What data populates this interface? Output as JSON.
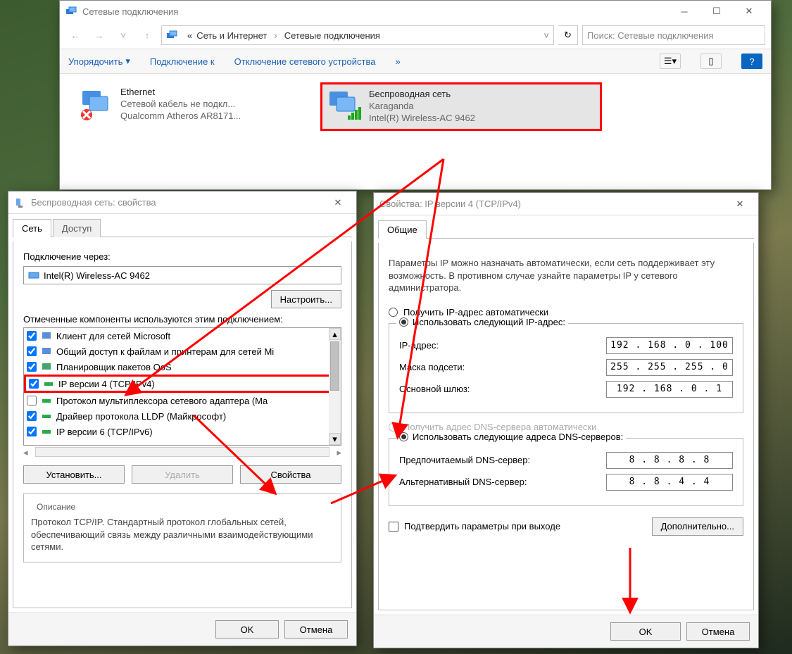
{
  "explorer": {
    "title": "Сетевые подключения",
    "breadcrumb": {
      "root": "«",
      "p1": "Сеть и Интернет",
      "p2": "Сетевые подключения"
    },
    "search_placeholder": "Поиск: Сетевые подключения",
    "cmdbar": {
      "organize": "Упорядочить",
      "connect": "Подключение к",
      "disable": "Отключение сетевого устройства",
      "chev": "»"
    },
    "ethernet": {
      "name": "Ethernet",
      "status": "Сетевой кабель не подкл...",
      "device": "Qualcomm Atheros AR8171..."
    },
    "wireless": {
      "name": "Беспроводная сеть",
      "status": "Karaganda",
      "device": "Intel(R) Wireless-AC 9462"
    }
  },
  "dlg_props": {
    "title": "Беспроводная сеть: свойства",
    "tab_net": "Сеть",
    "tab_access": "Доступ",
    "connect_via_label": "Подключение через:",
    "adapter_name": "Intel(R) Wireless-AC 9462",
    "configure_btn": "Настроить...",
    "components_label": "Отмеченные компоненты используются этим подключением:",
    "items": [
      "Клиент для сетей Microsoft",
      "Общий доступ к файлам и принтерам для сетей Mi",
      "Планировщик пакетов QoS",
      "IP версии 4 (TCP/IPv4)",
      "Протокол мультиплексора сетевого адаптера (Ma",
      "Драйвер протокола LLDP (Майкрософт)",
      "IP версии 6 (TCP/IPv6)"
    ],
    "install_btn": "Установить...",
    "remove_btn": "Удалить",
    "props_btn": "Свойства",
    "desc_title": "Описание",
    "desc_text": "Протокол TCP/IP. Стандартный протокол глобальных сетей, обеспечивающий связь между различными взаимодействующими сетями.",
    "ok": "OK",
    "cancel": "Отмена"
  },
  "dlg_ip": {
    "title": "Свойства: IP версии 4 (TCP/IPv4)",
    "tab_general": "Общие",
    "para": "Параметры IP можно назначать автоматически, если сеть поддерживает эту возможность. В противном случае узнайте параметры IP у сетевого администратора.",
    "opt_auto_ip": "Получить IP-адрес автоматически",
    "opt_static_ip": "Использовать следующий IP-адрес:",
    "lbl_ip": "IP-адрес:",
    "val_ip": "192 . 168 .  0  . 100",
    "lbl_mask": "Маска подсети:",
    "val_mask": "255 . 255 . 255 .  0",
    "lbl_gw": "Основной шлюз:",
    "val_gw": "192 . 168 .  0  .  1",
    "opt_auto_dns": "Получить адрес DNS-сервера автоматически",
    "opt_static_dns": "Использовать следующие адреса DNS-серверов:",
    "lbl_dns1": "Предпочитаемый DNS-сервер:",
    "val_dns1": "8  .  8  .  8  .  8",
    "lbl_dns2": "Альтернативный DNS-сервер:",
    "val_dns2": "8  .  8  .  4  .  4",
    "validate_on_exit": "Подтвердить параметры при выходе",
    "advanced_btn": "Дополнительно...",
    "ok": "OK",
    "cancel": "Отмена"
  }
}
